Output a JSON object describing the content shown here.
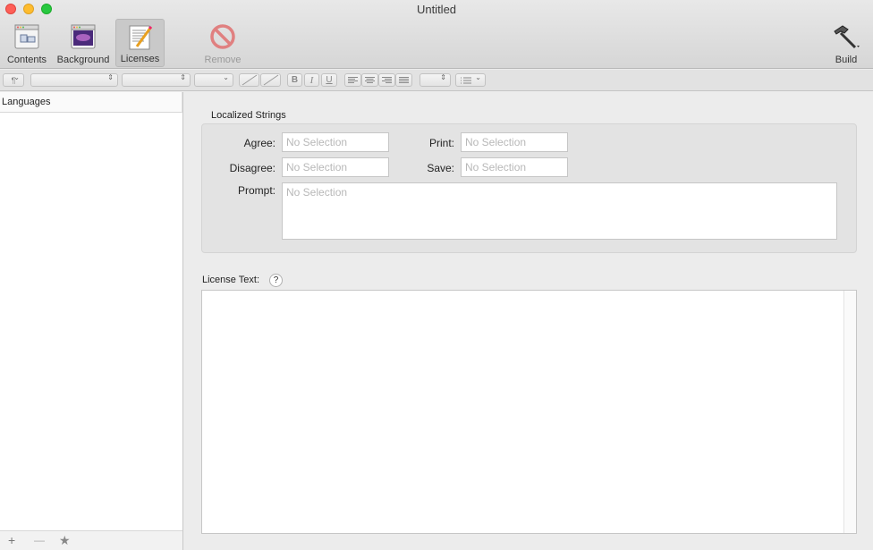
{
  "window": {
    "title": "Untitled"
  },
  "toolbar": {
    "contents_label": "Contents",
    "background_label": "Background",
    "licenses_label": "Licenses",
    "remove_label": "Remove",
    "build_label": "Build"
  },
  "formatbar": {
    "paragraph": "¶",
    "bold": "B",
    "italic": "I",
    "underline": "U"
  },
  "sidebar": {
    "header": "Languages",
    "add": "+",
    "remove": "—",
    "star": "★"
  },
  "localized": {
    "title": "Localized Strings",
    "agree_label": "Agree:",
    "disagree_label": "Disagree:",
    "prompt_label": "Prompt:",
    "print_label": "Print:",
    "save_label": "Save:",
    "agree_value": "No Selection",
    "disagree_value": "No Selection",
    "prompt_value": "No Selection",
    "print_value": "No Selection",
    "save_value": "No Selection"
  },
  "license": {
    "label": "License Text:",
    "help": "?"
  }
}
